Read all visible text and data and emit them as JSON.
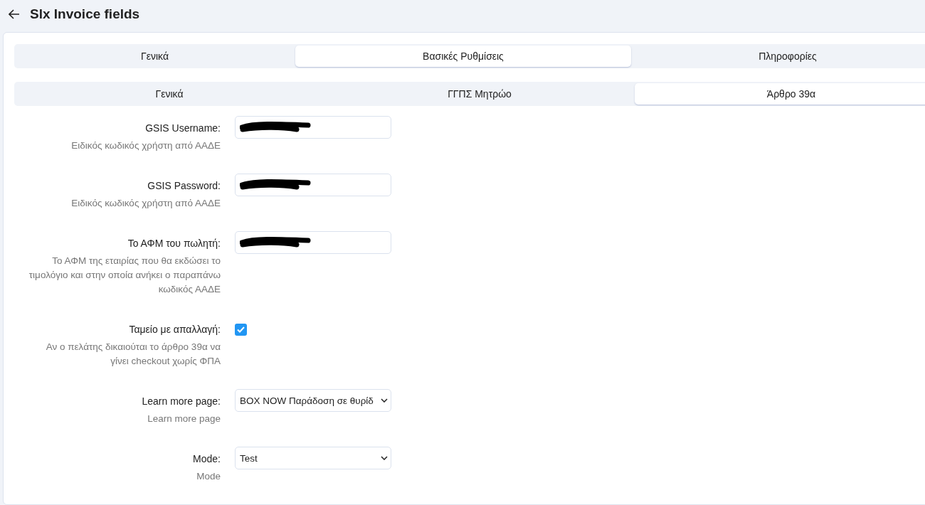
{
  "header": {
    "title": "Slx Invoice fields"
  },
  "tabs": [
    {
      "label": "Γενικά",
      "selected": false
    },
    {
      "label": "Βασικές Ρυθμίσεις",
      "selected": true
    },
    {
      "label": "Πληροφορίες",
      "selected": false
    }
  ],
  "subtabs": [
    {
      "label": "Γενικά",
      "selected": false
    },
    {
      "label": "ΓΓΠΣ Μητρώο",
      "selected": false
    },
    {
      "label": "Άρθρο 39α",
      "selected": true
    }
  ],
  "fields": [
    {
      "kind": "redacted",
      "label": "GSIS Username:",
      "hint": "Ειδικός κωδικός χρήστη από ΑΑΔΕ"
    },
    {
      "kind": "redacted",
      "label": "GSIS Password:",
      "hint": "Ειδικός κωδικός χρήστη από ΑΑΔΕ"
    },
    {
      "kind": "redacted",
      "label": "Το ΑΦΜ του πωλητή:",
      "hint": "Το ΑΦΜ της εταιρίας που θα εκδώσει το τιμολόγιο και στην οποία ανήκει ο παραπάνω κωδικός ΑΑΔΕ"
    },
    {
      "kind": "checkbox",
      "label": "Ταμείο με απαλλαγή:",
      "hint": "Αν ο πελάτης δικαιούται το άρθρο 39α να γίνει checkout χωρίς ΦΠΑ",
      "checked": true
    },
    {
      "kind": "select",
      "label": "Learn more page:",
      "hint": "Learn more page",
      "value": "BOX NOW Παράδοση σε θυρίδ"
    },
    {
      "kind": "select",
      "label": "Mode:",
      "hint": "Mode",
      "value": "Test"
    }
  ]
}
